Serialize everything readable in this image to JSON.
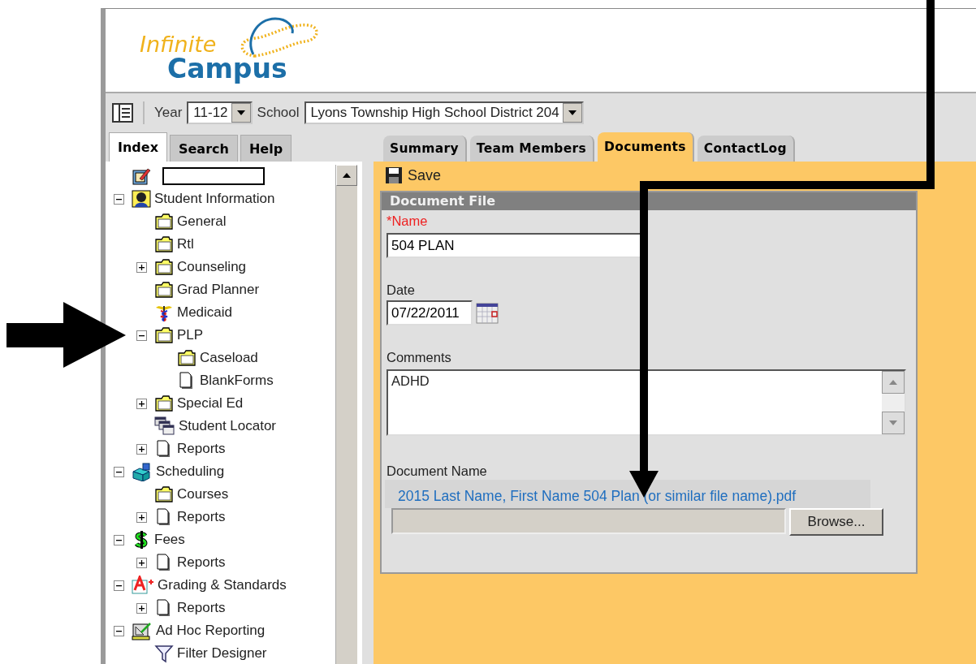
{
  "logo": {
    "line_1": "Infinite",
    "line_2": "Campus"
  },
  "toolbar": {
    "year_label": "Year",
    "year_value": "11-12",
    "school_label": "School",
    "school_value": "Lyons Township High School District 204"
  },
  "left_tabs": [
    {
      "label": "Index",
      "selected": true
    },
    {
      "label": "Search",
      "selected": false
    },
    {
      "label": "Help",
      "selected": false
    }
  ],
  "tree": [
    {
      "kind": "edit"
    },
    {
      "label": "Student Information",
      "kind": "student",
      "expanded": true,
      "children": [
        {
          "label": "General",
          "kind": "folder"
        },
        {
          "label": "Rtl",
          "kind": "folder"
        },
        {
          "label": "Counseling",
          "kind": "folder",
          "expanded": false
        },
        {
          "label": "Grad Planner",
          "kind": "folder"
        },
        {
          "label": "Medicaid",
          "kind": "medical"
        },
        {
          "label": "PLP",
          "kind": "folder",
          "expanded": true,
          "children": [
            {
              "label": "Caseload",
              "kind": "folder"
            },
            {
              "label": "BlankForms",
              "kind": "page"
            }
          ]
        },
        {
          "label": "Special Ed",
          "kind": "folder",
          "expanded": false
        },
        {
          "label": "Student Locator",
          "kind": "locator"
        },
        {
          "label": "Reports",
          "kind": "page",
          "expanded": false
        }
      ]
    },
    {
      "label": "Scheduling",
      "kind": "scheduling",
      "expanded": true,
      "children": [
        {
          "label": "Courses",
          "kind": "folder"
        },
        {
          "label": "Reports",
          "kind": "page",
          "expanded": false
        }
      ]
    },
    {
      "label": "Fees",
      "kind": "fees",
      "expanded": true,
      "children": [
        {
          "label": "Reports",
          "kind": "page",
          "expanded": false
        }
      ]
    },
    {
      "label": "Grading & Standards",
      "kind": "grading",
      "expanded": true,
      "children": [
        {
          "label": "Reports",
          "kind": "page",
          "expanded": false
        }
      ]
    },
    {
      "label": "Ad Hoc Reporting",
      "kind": "adhoc",
      "expanded": true,
      "children": [
        {
          "label": "Filter Designer",
          "kind": "filter"
        }
      ]
    }
  ],
  "main_tabs": [
    {
      "label": "Summary",
      "selected": false
    },
    {
      "label": "Team Members",
      "selected": false
    },
    {
      "label": "Documents",
      "selected": true
    },
    {
      "label": "ContactLog",
      "selected": false
    }
  ],
  "save_button": "Save",
  "form": {
    "title": "Document File",
    "name_label": "*Name",
    "name_value": "504 PLAN",
    "date_label": "Date",
    "date_value": "07/22/2011",
    "comments_label": "Comments",
    "comments_value": "ADHD",
    "document_name_label": "Document Name",
    "file_note": "2015 Last Name, First Name 504 Plan (or similar file name).pdf",
    "browse_button": "Browse..."
  }
}
